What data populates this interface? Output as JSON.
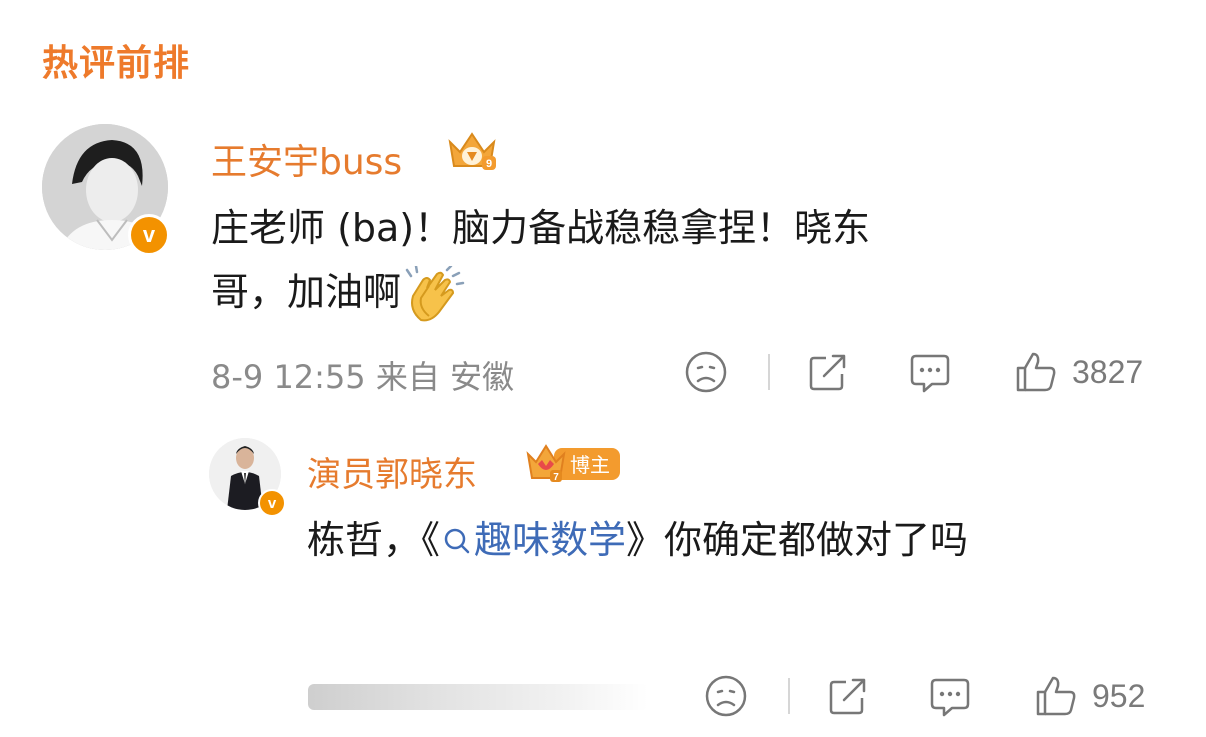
{
  "header": {
    "title": "热评前排"
  },
  "comment": {
    "author": "王安宇buss",
    "badge": "v",
    "text_part1": "庄老师 (ba)！脑力备战稳稳拿捏！晓东",
    "text_part2": "哥，加油啊",
    "emoji": "clapping-hands",
    "meta": "8-9 12:55 来自 安徽",
    "likes": "3827"
  },
  "reply": {
    "author": "演员郭晓东",
    "badge": "v",
    "role_tag": "博主",
    "level": "7",
    "text_before": "栋哲，《",
    "topic": "趣味数学",
    "text_after": "》你确定都做对了吗",
    "likes": "952"
  },
  "colors": {
    "accent_orange": "#ee7a2b",
    "topic_blue": "#3e6bb7",
    "meta_gray": "#8a8a8a"
  },
  "icons": [
    "sad-face-icon",
    "share-icon",
    "comment-icon",
    "thumbs-up-icon",
    "search-icon"
  ]
}
